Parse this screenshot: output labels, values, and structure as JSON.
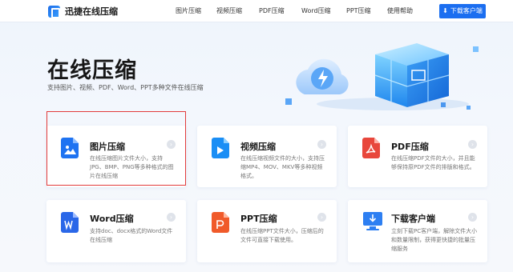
{
  "app": {
    "logo_text": "迅捷在线压缩"
  },
  "nav": {
    "items": [
      "图片压缩",
      "视频压缩",
      "PDF压缩",
      "Word压缩",
      "PPT压缩",
      "使用帮助"
    ],
    "download_label": "下载客户端"
  },
  "hero": {
    "title": "在线压缩",
    "subtitle": "支持图片、视频、PDF、Word、PPT多种文件在线压缩"
  },
  "cards": [
    {
      "title": "图片压缩",
      "desc": "在线压缩图片文件大小，支持JPG、BMP、PNG等多种格式的图片在线压缩",
      "color": "#1f73f1",
      "icon": "image-file-icon"
    },
    {
      "title": "视频压缩",
      "desc": "在线压缩视频文件的大小，支持压缩MP4、MOV、MKV等多种视频格式。",
      "color": "#1a8ef5",
      "icon": "video-file-icon"
    },
    {
      "title": "PDF压缩",
      "desc": "在线压缩PDF文件的大小，并且能够保持原PDF文件的排版和格式。",
      "color": "#e8473c",
      "icon": "pdf-file-icon"
    },
    {
      "title": "Word压缩",
      "desc": "支持doc、docx格式的Word文件在线压缩",
      "color": "#2a67e8",
      "icon": "word-file-icon"
    },
    {
      "title": "PPT压缩",
      "desc": "在线压缩PPT文件大小，压缩后的文件可直接下载使用。",
      "color": "#f05a2a",
      "icon": "ppt-file-icon"
    },
    {
      "title": "下载客户端",
      "desc": "立刻下载PC客户端，解除文件大小和数量限制，获得更快捷的批量压缩服务",
      "color": "#2d7ff2",
      "icon": "download-monitor-icon"
    }
  ]
}
